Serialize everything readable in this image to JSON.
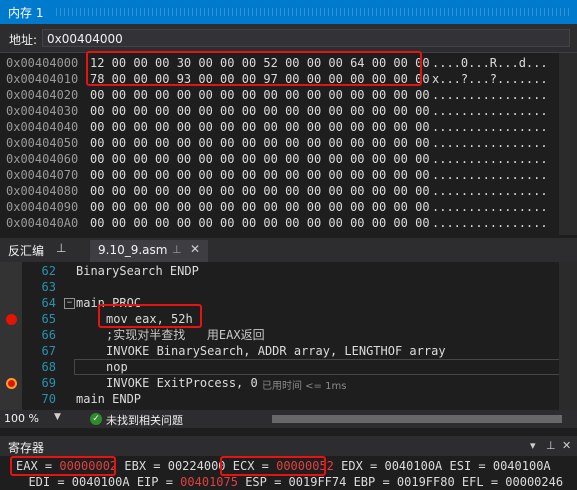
{
  "memory": {
    "title": "内存 1",
    "address_label": "地址:",
    "address_value": "0x00404000",
    "rows": [
      {
        "addr": "0x00404000",
        "hex": "12 00 00 00 30 00 00 00 52 00 00 00 64 00 00 00",
        "ascii": "....0...R...d..."
      },
      {
        "addr": "0x00404010",
        "hex": "78 00 00 00 93 00 00 00 97 00 00 00 00 00 00 00",
        "ascii": "x...?...?......."
      },
      {
        "addr": "0x00404020",
        "hex": "00 00 00 00 00 00 00 00 00 00 00 00 00 00 00 00",
        "ascii": "................"
      },
      {
        "addr": "0x00404030",
        "hex": "00 00 00 00 00 00 00 00 00 00 00 00 00 00 00 00",
        "ascii": "................"
      },
      {
        "addr": "0x00404040",
        "hex": "00 00 00 00 00 00 00 00 00 00 00 00 00 00 00 00",
        "ascii": "................"
      },
      {
        "addr": "0x00404050",
        "hex": "00 00 00 00 00 00 00 00 00 00 00 00 00 00 00 00",
        "ascii": "................"
      },
      {
        "addr": "0x00404060",
        "hex": "00 00 00 00 00 00 00 00 00 00 00 00 00 00 00 00",
        "ascii": "................"
      },
      {
        "addr": "0x00404070",
        "hex": "00 00 00 00 00 00 00 00 00 00 00 00 00 00 00 00",
        "ascii": "................"
      },
      {
        "addr": "0x00404080",
        "hex": "00 00 00 00 00 00 00 00 00 00 00 00 00 00 00 00",
        "ascii": "................"
      },
      {
        "addr": "0x00404090",
        "hex": "00 00 00 00 00 00 00 00 00 00 00 00 00 00 00 00",
        "ascii": "................"
      },
      {
        "addr": "0x004040A0",
        "hex": "00 00 00 00 00 00 00 00 00 00 00 00 00 00 00 00",
        "ascii": "................"
      }
    ]
  },
  "tabs": {
    "disasm_label": "反汇编",
    "file_tab": "9.10_9.asm"
  },
  "code": {
    "lines": [
      {
        "num": "62",
        "text": "BinarySearch ENDP"
      },
      {
        "num": "63",
        "text": ""
      },
      {
        "num": "64",
        "text": "main PROC"
      },
      {
        "num": "65",
        "text": "mov eax, 52h"
      },
      {
        "num": "66",
        "text": ";实现对半查找   用EAX返回"
      },
      {
        "num": "67",
        "text": "INVOKE BinarySearch, ADDR array, LENGTHOF array"
      },
      {
        "num": "68",
        "text": "nop"
      },
      {
        "num": "69",
        "text": "INVOKE ExitProcess, 0"
      },
      {
        "num": "70",
        "text": "main ENDP"
      }
    ],
    "elapsed_hint": "已用时间 <= 1ms"
  },
  "status": {
    "zoom": "100 %",
    "issues": "未找到相关问题"
  },
  "registers": {
    "title": "寄存器",
    "line1": {
      "eax_label": "EAX = ",
      "eax": "00000002",
      "ebx": " EBX = 00224000 ",
      "ecx_label": "ECX = ",
      "ecx": "00000052",
      "rest": " EDX = 0040100A ESI = 0040100A"
    },
    "line2": {
      "pre": "  EDI = 0040100A EIP = ",
      "eip": "00401075",
      "rest": " ESP = 0019FF74 EBP = 0019FF80 EFL = 00000246"
    }
  },
  "colors": {
    "accent": "#007acc",
    "highlight": "#e51414",
    "changed_register": "#e04040"
  }
}
